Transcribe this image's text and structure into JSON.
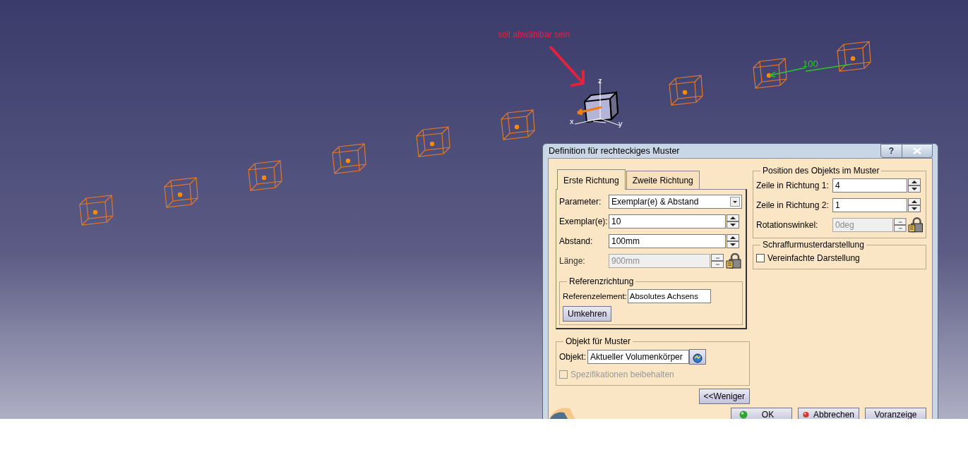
{
  "viewport": {
    "annotation": "soll abwählbar sein",
    "dimension": "100",
    "axes": [
      "x",
      "y",
      "z"
    ],
    "instances": [
      {
        "selected": false
      },
      {
        "selected": false
      },
      {
        "selected": false
      },
      {
        "selected": false
      },
      {
        "selected": false
      },
      {
        "selected": false
      },
      {
        "selected": true
      },
      {
        "selected": false
      },
      {
        "selected": false
      },
      {
        "selected": false
      }
    ]
  },
  "dialog": {
    "title": "Definition für rechteckiges Muster",
    "help": "?",
    "tabs": [
      {
        "label": "Erste Richtung",
        "selected": true
      },
      {
        "label": "Zweite Richtung",
        "selected": false
      }
    ],
    "direction_fields": [
      {
        "label": "Parameter:",
        "kind": "dropdown",
        "value": "Exemplar(e) & Abstand",
        "disabled": false
      },
      {
        "label": "Exemplar(e):",
        "kind": "spinner",
        "value": "10",
        "disabled": false
      },
      {
        "label": "Abstand:",
        "kind": "spinner",
        "value": "100mm",
        "disabled": false
      },
      {
        "label": "Länge:",
        "kind": "spinner",
        "value": "900mm",
        "disabled": true
      }
    ],
    "reference": {
      "title": "Referenzrichtung",
      "label": "Referenzelement:",
      "value": "Absolutes Achsens",
      "button": "Umkehren"
    },
    "position": {
      "title": "Position des Objekts im Muster",
      "fields": [
        {
          "label": "Zeile in Richtung 1:",
          "value": "4",
          "disabled": false
        },
        {
          "label": "Zeile in Richtung 2:",
          "value": "1",
          "disabled": false
        },
        {
          "label": "Rotationswinkel:",
          "value": "0deg",
          "disabled": true
        }
      ]
    },
    "hatching": {
      "title": "Schraffurmusterdarstellung",
      "checkbox": {
        "label": "Vereinfachte Darstellung",
        "checked": false,
        "disabled": false
      }
    },
    "object": {
      "title": "Objekt für Muster",
      "label": "Objekt:",
      "value": "Aktueller Volumenkörper",
      "checkbox": {
        "label": "Spezifikationen beibehalten",
        "checked": false,
        "disabled": true
      }
    },
    "less_button": "<<Weniger",
    "buttons": [
      {
        "label": "OK",
        "kind": "ok"
      },
      {
        "label": "Abbrechen",
        "kind": "cancel"
      },
      {
        "label": "Voranzeige",
        "kind": "plain"
      }
    ]
  }
}
